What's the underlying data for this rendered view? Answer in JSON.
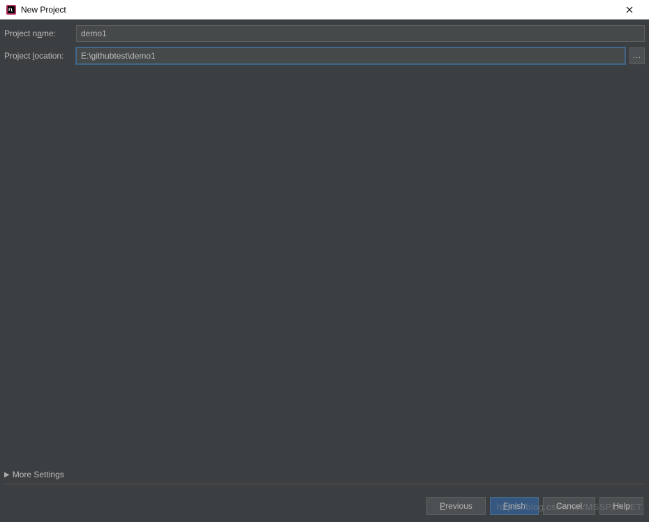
{
  "window": {
    "title": "New Project"
  },
  "form": {
    "name_label_prefix": "Project n",
    "name_label_mnemonic": "a",
    "name_label_suffix": "me:",
    "name_value": "demo1",
    "location_label_prefix": "Project ",
    "location_label_mnemonic": "l",
    "location_label_suffix": "ocation:",
    "location_value": "E:\\githubtest\\demo1",
    "browse_label": "..."
  },
  "more_settings": {
    "label": "More Settings"
  },
  "buttons": {
    "previous_mnemonic": "P",
    "previous_suffix": "revious",
    "finish_mnemonic": "F",
    "finish_suffix": "inish",
    "cancel": "Cancel",
    "help": "Help"
  },
  "watermark": "https://blog.csdn.net/MSSPLANET"
}
